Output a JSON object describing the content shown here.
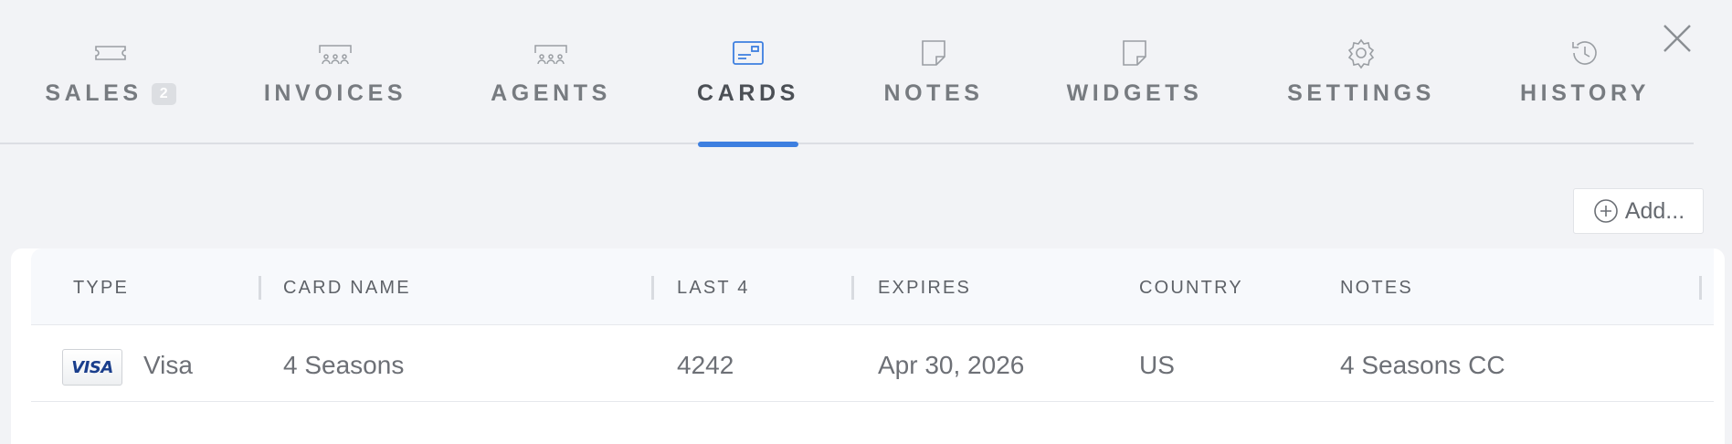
{
  "tabs": [
    {
      "label": "SALES",
      "icon": "ticket-icon",
      "badge": "2",
      "active": false
    },
    {
      "label": "INVOICES",
      "icon": "theater-seats-icon",
      "active": false
    },
    {
      "label": "AGENTS",
      "icon": "theater-seats-icon",
      "active": false
    },
    {
      "label": "CARDS",
      "icon": "credit-card-icon",
      "active": true
    },
    {
      "label": "NOTES",
      "icon": "sticky-note-icon",
      "active": false
    },
    {
      "label": "WIDGETS",
      "icon": "sticky-note-icon",
      "active": false
    },
    {
      "label": "SETTINGS",
      "icon": "gear-icon",
      "active": false
    },
    {
      "label": "HISTORY",
      "icon": "history-icon",
      "active": false
    }
  ],
  "toolbar": {
    "add_label": "Add..."
  },
  "table": {
    "columns": [
      "TYPE",
      "CARD NAME",
      "LAST 4",
      "EXPIRES",
      "COUNTRY",
      "NOTES"
    ],
    "rows": [
      {
        "type_logo": "VISA",
        "type": "Visa",
        "card_name": "4 Seasons",
        "last4": "4242",
        "expires": "Apr 30, 2026",
        "country": "US",
        "notes": "4 Seasons CC"
      }
    ]
  },
  "colors": {
    "accent": "#3d7fe0",
    "background": "#f2f3f6",
    "visa_blue": "#1a3e8c"
  }
}
